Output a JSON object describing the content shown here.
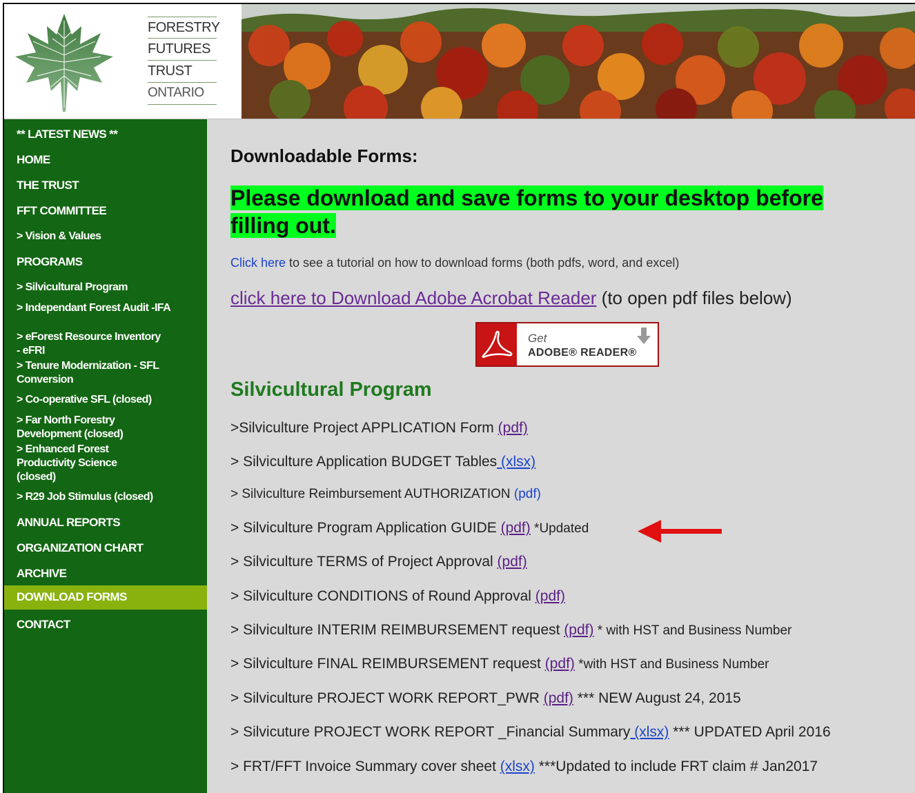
{
  "logo": {
    "lines": [
      "FORESTRY",
      "FUTURES",
      "TRUST",
      "ONTARIO"
    ]
  },
  "sidebar": {
    "items": [
      {
        "label": "** LATEST NEWS **"
      },
      {
        "label": "HOME"
      },
      {
        "label": "THE TRUST"
      },
      {
        "label": "FFT COMMITTEE"
      },
      {
        "label": "> Vision & Values"
      },
      {
        "label": "PROGRAMS"
      },
      {
        "label": "> Silvicultural Program"
      },
      {
        "label": "> Independant Forest Audit -IFA"
      },
      {
        "label": "> eForest Resource Inventory - eFRI"
      },
      {
        "label": "> Tenure Modernization - SFL Conversion"
      },
      {
        "label": "> Co-operative SFL (closed)"
      },
      {
        "label": "> Far North Forestry Development (closed)"
      },
      {
        "label": "> Enhanced Forest Productivity Science (closed)"
      },
      {
        "label": "> R29 Job Stimulus (closed)"
      },
      {
        "label": "ANNUAL REPORTS"
      },
      {
        "label": "ORGANIZATION CHART"
      },
      {
        "label": "ARCHIVE"
      },
      {
        "label": "DOWNLOAD FORMS"
      },
      {
        "label": "CONTACT"
      }
    ]
  },
  "content": {
    "title": "Downloadable Forms:",
    "notice": "Please download and save forms to your desktop before filling out.",
    "tutorial_link": "Click here",
    "tutorial_text": " to see a tutorial on how to download forms (both pdfs, word, and excel)",
    "adobe_link": "click here to Download Adobe Acrobat Reader",
    "adobe_text": " (to open pdf files below)",
    "adobe_badge": {
      "get": "Get",
      "reader": "ADOBE® READER®"
    },
    "section_title": "Silvicultural Program",
    "forms": [
      {
        "prefix": ">Silviculture Project APPLICATION Form ",
        "link": "(pdf)",
        "suffix": ""
      },
      {
        "prefix": "> Silviculture Application BUDGET Tables",
        "link": " (xlsx) ",
        "suffix": ""
      },
      {
        "prefix": "> Silviculture Reimbursement AUTHORIZATION ",
        "link": "(pdf)",
        "suffix": ""
      },
      {
        "prefix": "> Silviculture Program Application GUIDE ",
        "link": "(pdf)",
        "suffix": " *Updated"
      },
      {
        "prefix": "> Silviculture TERMS of Project  Approval ",
        "link": "(pdf)",
        "suffix": ""
      },
      {
        "prefix": "> Silviculture CONDITIONS of Round Approval  ",
        "link": "(pdf)",
        "suffix": ""
      },
      {
        "prefix": "> Silviculture INTERIM REIMBURSEMENT request ",
        "link": "(pdf)",
        "suffix": " * with HST and Business Number"
      },
      {
        "prefix": "> Silviculture FINAL REIMBURSEMENT request ",
        "link": "(pdf)",
        "suffix": "  *with HST and Business Number"
      },
      {
        "prefix": "> Silviculture PROJECT WORK REPORT_PWR ",
        "link": "(pdf)",
        "suffix": " *** NEW August 24, 2015"
      },
      {
        "prefix": "> Silvicuture PROJECT WORK REPORT _Financial Summary",
        "link": " (xlsx)",
        "suffix": " *** UPDATED April 2016"
      },
      {
        "prefix": "> FRT/FFT Invoice Summary cover sheet ",
        "link": "(xlsx)",
        "suffix": " ***Updated to include FRT claim # Jan2017"
      }
    ]
  },
  "colors": {
    "sidebar_bg": "#136613",
    "active_nav": "#8ab20f",
    "notice_highlight": "#00ff1e",
    "section_title": "#1f7a1f",
    "arrow": "#e01010"
  }
}
